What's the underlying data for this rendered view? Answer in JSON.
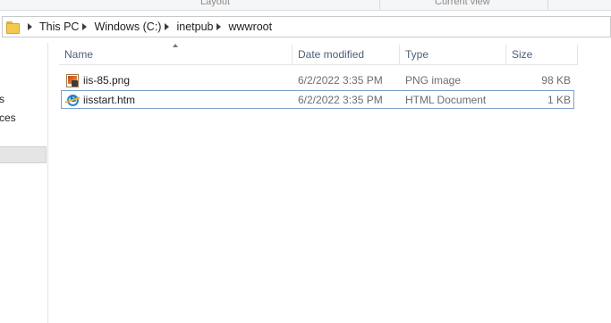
{
  "ribbon": {
    "groups": [
      "Layout",
      "Current view"
    ]
  },
  "address_bar": {
    "folder_icon": "folder-icon",
    "crumbs": [
      "This PC",
      "Windows (C:)",
      "inetpub",
      "wwwroot"
    ]
  },
  "nav_pane": {
    "items": [
      "s",
      "ces"
    ]
  },
  "file_list": {
    "columns": [
      "Name",
      "Date modified",
      "Type",
      "Size"
    ],
    "sort_column": "Name",
    "rows": [
      {
        "name": "iis-85.png",
        "date": "6/2/2022 3:35 PM",
        "type": "PNG image",
        "size": "98 KB",
        "icon": "png-image-icon",
        "selected": false
      },
      {
        "name": "iisstart.htm",
        "date": "6/2/2022 3:35 PM",
        "type": "HTML Document",
        "size": "1 KB",
        "icon": "internet-explorer-icon",
        "selected": true
      }
    ]
  },
  "colors": {
    "header_text": "#4c607a",
    "selection_border": "#7da2ce",
    "folder": "#f4c94f"
  }
}
